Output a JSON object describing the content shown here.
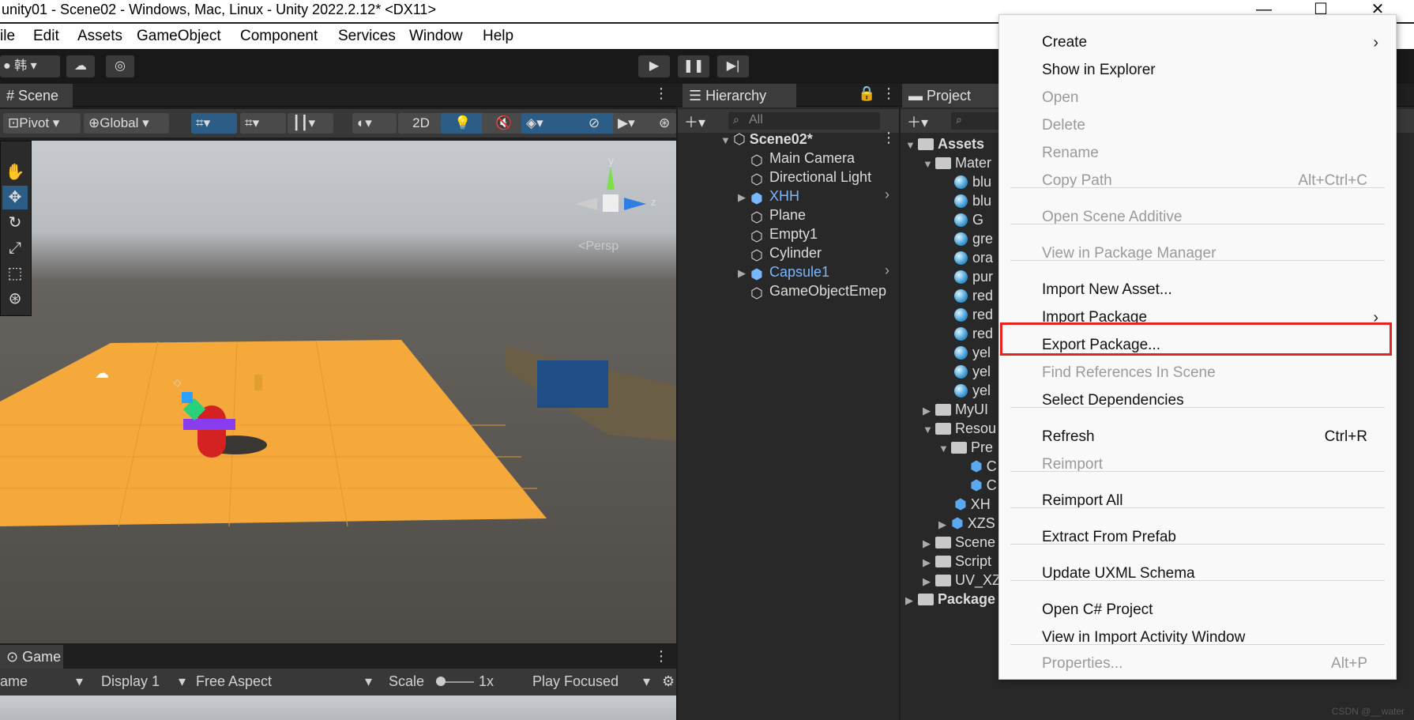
{
  "window": {
    "title": "unity01 - Scene02 - Windows, Mac, Linux - Unity 2022.2.12* <DX11>",
    "minimize": "—",
    "maximize": "☐",
    "close": "✕"
  },
  "menubar": [
    "ile",
    "Edit",
    "Assets",
    "GameObject",
    "Component",
    "Services",
    "Window",
    "Help"
  ],
  "toolbar": {
    "account_label": "韩"
  },
  "scene": {
    "tab": "Scene",
    "pivot": "Pivot",
    "global": "Global",
    "mode_2d": "2D",
    "gizmo_y": "y",
    "gizmo_z": "z",
    "persp": "<Persp"
  },
  "hierarchy": {
    "tab": "Hierarchy",
    "search_placeholder": "All",
    "items": [
      {
        "name": "Scene02*",
        "kind": "scene"
      },
      {
        "name": "Main Camera",
        "kind": "object"
      },
      {
        "name": "Directional Light",
        "kind": "object"
      },
      {
        "name": "XHH",
        "kind": "prefab"
      },
      {
        "name": "Plane",
        "kind": "object"
      },
      {
        "name": "Empty1",
        "kind": "object"
      },
      {
        "name": "Cylinder",
        "kind": "object"
      },
      {
        "name": "Capsule1",
        "kind": "prefab"
      },
      {
        "name": "GameObjectEmep",
        "kind": "object"
      }
    ]
  },
  "project": {
    "tab": "Project",
    "items": [
      {
        "name": "Assets",
        "kind": "root"
      },
      {
        "name": "Mater",
        "kind": "folder"
      },
      {
        "name": "blu",
        "kind": "material"
      },
      {
        "name": "blu",
        "kind": "material"
      },
      {
        "name": "G",
        "kind": "material"
      },
      {
        "name": "gre",
        "kind": "material"
      },
      {
        "name": "ora",
        "kind": "material"
      },
      {
        "name": "pur",
        "kind": "material"
      },
      {
        "name": "red",
        "kind": "material"
      },
      {
        "name": "red",
        "kind": "material"
      },
      {
        "name": "red",
        "kind": "material"
      },
      {
        "name": "yel",
        "kind": "material"
      },
      {
        "name": "yel",
        "kind": "material"
      },
      {
        "name": "yel",
        "kind": "material"
      },
      {
        "name": "MyUI",
        "kind": "folder"
      },
      {
        "name": "Resou",
        "kind": "folder"
      },
      {
        "name": "Pre",
        "kind": "folder"
      },
      {
        "name": "C",
        "kind": "prefab"
      },
      {
        "name": "C",
        "kind": "prefab"
      },
      {
        "name": "XH",
        "kind": "prefab"
      },
      {
        "name": "XZS",
        "kind": "prefab"
      },
      {
        "name": "Scene",
        "kind": "folder"
      },
      {
        "name": "Script",
        "kind": "folder"
      },
      {
        "name": "UV_XZ",
        "kind": "folder"
      },
      {
        "name": "Package",
        "kind": "root"
      }
    ]
  },
  "game": {
    "tab": "Game",
    "name_dropdown": "ame",
    "display": "Display 1",
    "aspect": "Free Aspect",
    "scale_label": "Scale",
    "scale_value": "1x",
    "play_mode": "Play Focused"
  },
  "context_menu": {
    "items": [
      {
        "label": "Create",
        "shortcut": "",
        "disabled": false,
        "submenu": true
      },
      {
        "label": "Show in Explorer",
        "shortcut": "",
        "disabled": false
      },
      {
        "label": "Open",
        "shortcut": "",
        "disabled": true
      },
      {
        "label": "Delete",
        "shortcut": "",
        "disabled": true
      },
      {
        "label": "Rename",
        "shortcut": "",
        "disabled": true
      },
      {
        "label": "Copy Path",
        "shortcut": "Alt+Ctrl+C",
        "disabled": true
      },
      {
        "label": "Open Scene Additive",
        "shortcut": "",
        "disabled": true
      },
      {
        "label": "View in Package Manager",
        "shortcut": "",
        "disabled": true
      },
      {
        "label": "Import New Asset...",
        "shortcut": "",
        "disabled": false
      },
      {
        "label": "Import Package",
        "shortcut": "",
        "disabled": false,
        "submenu": true
      },
      {
        "label": "Export Package...",
        "shortcut": "",
        "disabled": false,
        "highlighted": true
      },
      {
        "label": "Find References In Scene",
        "shortcut": "",
        "disabled": true
      },
      {
        "label": "Select Dependencies",
        "shortcut": "",
        "disabled": false
      },
      {
        "label": "Refresh",
        "shortcut": "Ctrl+R",
        "disabled": false
      },
      {
        "label": "Reimport",
        "shortcut": "",
        "disabled": true
      },
      {
        "label": "Reimport All",
        "shortcut": "",
        "disabled": false
      },
      {
        "label": "Extract From Prefab",
        "shortcut": "",
        "disabled": false
      },
      {
        "label": "Update UXML Schema",
        "shortcut": "",
        "disabled": false
      },
      {
        "label": "Open C# Project",
        "shortcut": "",
        "disabled": false
      },
      {
        "label": "View in Import Activity Window",
        "shortcut": "",
        "disabled": false
      },
      {
        "label": "Properties...",
        "shortcut": "Alt+P",
        "disabled": true
      }
    ]
  },
  "watermark": "CSDN @__water",
  "colors": {
    "highlight_box": "#e8231f",
    "prefab_text": "#7ab7ff",
    "active_tool": "#2c5d87",
    "plane": "#f4a93a"
  }
}
